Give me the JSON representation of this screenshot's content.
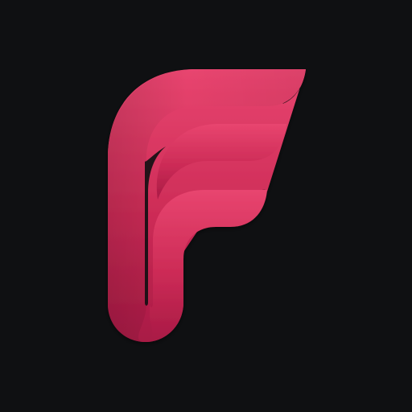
{
  "app_icon": {
    "logo_icon": "stylized-f-logo-icon",
    "background_color": "#0f1012",
    "logo_color_light": "#e8456f",
    "logo_color_dark": "#a81a45"
  }
}
